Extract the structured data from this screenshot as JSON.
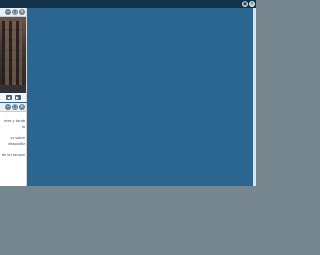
{
  "window": {
    "controls": [
      "restore-icon",
      "close-icon"
    ],
    "control_glyphs": [
      "▣",
      "×"
    ]
  },
  "photo_panel": {
    "header_controls": [
      "minimize-icon",
      "maximize-icon",
      "close-icon"
    ],
    "header_glyphs": [
      "−",
      "□",
      "×"
    ],
    "nav_glyphs": [
      "◀",
      "▶"
    ]
  },
  "text_panel": {
    "header_glyphs": [
      "−",
      "□",
      "×"
    ],
    "lines": [
      "ntes y tarde",
      "la",
      "",
      "pr sobre",
      "despolitiz",
      "",
      "de la tranquil"
    ]
  },
  "colors": {
    "desktop": "#2a668f",
    "topbar": "#123247",
    "taskbar_area": "#76868f",
    "panel_bg": "#ffffff"
  }
}
